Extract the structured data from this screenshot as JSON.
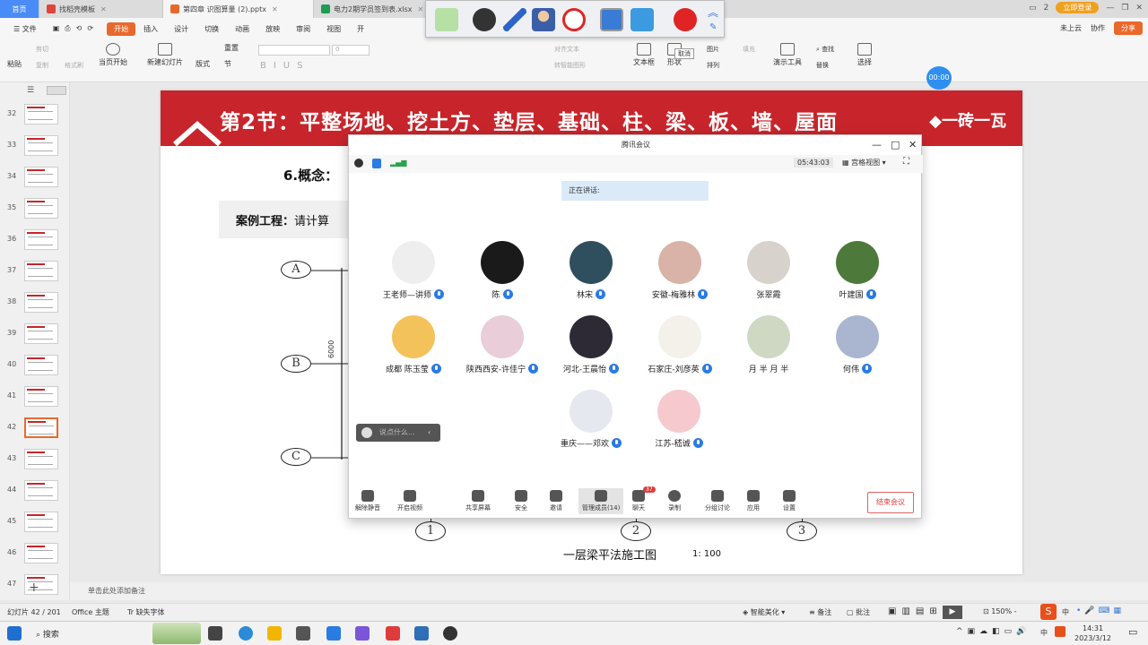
{
  "tabs": [
    {
      "label": "首页",
      "type": "home"
    },
    {
      "label": "找稻壳模板",
      "color": "#e0453c"
    },
    {
      "label": "第四章  识图算量 (2).pptx",
      "color": "#e9692c",
      "active": true
    },
    {
      "label": "电力2期学员签到表.xlsx",
      "color": "#1e9c52"
    }
  ],
  "tab_right": {
    "login": "立即登录",
    "counter": "2"
  },
  "menu": {
    "file": "文件",
    "items": [
      "开始",
      "插入",
      "设计",
      "切换",
      "动画",
      "放映",
      "审阅",
      "视图",
      "开"
    ],
    "cloud": "未上云",
    "collab": "协作",
    "share": "分享"
  },
  "ribbon": {
    "paste": "粘贴",
    "cut": "剪切",
    "copy": "复制",
    "format_painter": "格式刷",
    "play_from_current": "当页开始",
    "new_slide": "新建幻灯片",
    "layout": "版式",
    "section": "节",
    "reset": "重置",
    "align_text": "对齐文本",
    "convert_smartart": "转智能图形",
    "textbox": "文本框",
    "shape": "形状",
    "picture": "图片",
    "arrange": "排列",
    "fill": "填充",
    "presentation_tools": "演示工具",
    "find": "查找",
    "replace": "替换",
    "select": "选择",
    "tooltip_cancel": "取消",
    "font_size": "0"
  },
  "timer_badge": "00:00",
  "thumbnails": [
    {
      "n": "32"
    },
    {
      "n": "33"
    },
    {
      "n": "34"
    },
    {
      "n": "35"
    },
    {
      "n": "36"
    },
    {
      "n": "37"
    },
    {
      "n": "38"
    },
    {
      "n": "39"
    },
    {
      "n": "40"
    },
    {
      "n": "41"
    },
    {
      "n": "42",
      "selected": true
    },
    {
      "n": "43"
    },
    {
      "n": "44"
    },
    {
      "n": "45"
    },
    {
      "n": "46"
    },
    {
      "n": "47"
    }
  ],
  "slide": {
    "title": "第2节：平整场地、挖土方、垫层、基础、柱、梁、板、墙、屋面",
    "brand": "一砖一瓦",
    "concept": "6.概念：",
    "case_label": "案例工程：",
    "case_text": "请计算",
    "axis_left": [
      "A",
      "B",
      "C"
    ],
    "dim_label": "6000",
    "axis_bottom": [
      "1",
      "2",
      "3"
    ],
    "caption": "一层梁平法施工图",
    "scale": "1: 100"
  },
  "meeting": {
    "window_title": "腾讯会议",
    "duration": "05:43:03",
    "view_mode": "宫格视图",
    "speaking": "正在讲话:",
    "chat_placeholder": "说点什么...",
    "participants": [
      {
        "name": "王老师—讲师",
        "bg": "#eeeeee"
      },
      {
        "name": "陈",
        "bg": "#1a1a1a"
      },
      {
        "name": "林宋",
        "bg": "#2f4f5f"
      },
      {
        "name": "安徽-梅雅林",
        "bg": "#d9b3a8"
      },
      {
        "name": "张翠霞",
        "bg": "#d8d2cc",
        "nomic": true
      },
      {
        "name": "叶建国",
        "bg": "#4d7a3a"
      },
      {
        "name": "成都 陈玉莹",
        "bg": "#f3c25a"
      },
      {
        "name": "陕西西安-许佳宁",
        "bg": "#e9cdd8"
      },
      {
        "name": "河北-王晨怡",
        "bg": "#2d2a35"
      },
      {
        "name": "石家庄-刘彦英",
        "bg": "#f4f0ea"
      },
      {
        "name": "月 半 月 半",
        "bg": "#cfd8c3",
        "nomic": true
      },
      {
        "name": "何伟",
        "bg": "#aab6cf"
      },
      {
        "name": "重庆——邓欢",
        "bg": "#e5e8ef"
      },
      {
        "name": "江苏-嵇诚",
        "bg": "#f6c9cf"
      }
    ],
    "toolbar": {
      "mute": "解除静音",
      "video": "开启视频",
      "share": "共享屏幕",
      "security": "安全",
      "invite": "邀请",
      "members": "管理成员(14)",
      "chat": "聊天",
      "chat_badge": "37",
      "record": "录制",
      "breakout": "分组讨论",
      "apps": "应用",
      "settings": "设置",
      "end": "结束会议"
    }
  },
  "notes_placeholder": "单击此处添加备注",
  "status": {
    "slide_counter": "幻灯片 42 / 201",
    "theme": "Office 主题",
    "missing_font": "缺失字体",
    "beautify": "智能美化",
    "notes": "备注",
    "comments": "批注",
    "zoom": "150%"
  },
  "taskbar": {
    "search": "搜索",
    "ime1": "中",
    "ime2": "中",
    "time": "14:31",
    "date": "2023/3/12"
  }
}
